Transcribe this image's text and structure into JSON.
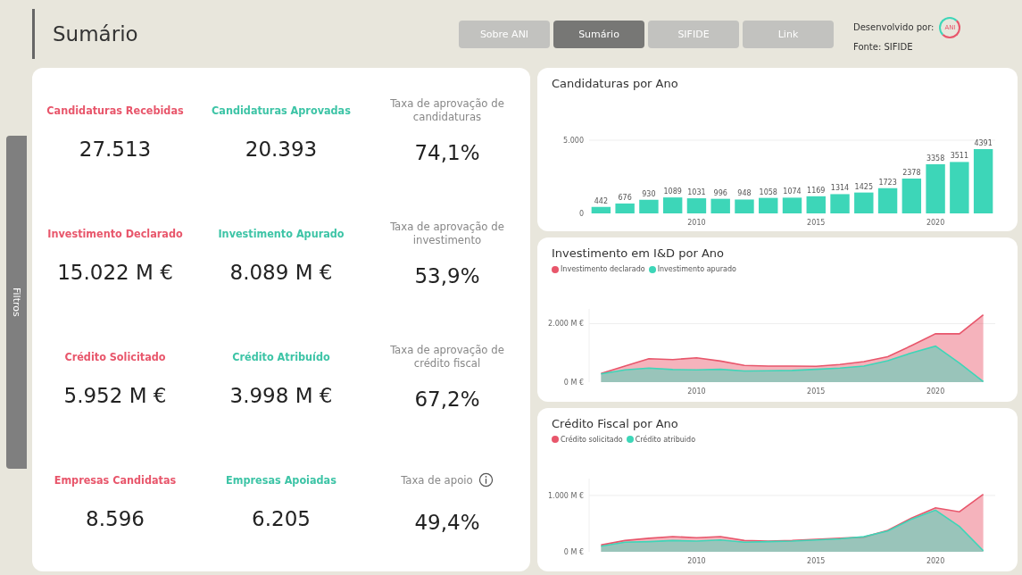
{
  "header": {
    "title": "Sumário",
    "nav": [
      {
        "label": "Sobre ANI",
        "selected": false
      },
      {
        "label": "Sumário",
        "selected": true
      },
      {
        "label": "SIFIDE",
        "selected": false
      },
      {
        "label": "Link",
        "selected": false
      }
    ],
    "developed_by": "Desenvolvido por:",
    "logo_text": "ANI",
    "source": "Fonte: SIFIDE"
  },
  "filters_tab": "Filtros",
  "kpis": [
    [
      {
        "kind": "declared",
        "label": "Candidaturas Recebidas",
        "value": "27.513"
      },
      {
        "kind": "approved",
        "label": "Candidaturas Aprovadas",
        "value": "20.393"
      },
      {
        "kind": "rate",
        "label": "Taxa de aprovação de candidaturas",
        "value": "74,1%",
        "info": false
      }
    ],
    [
      {
        "kind": "declared",
        "label": "Investimento Declarado",
        "value": "15.022 M €"
      },
      {
        "kind": "approved",
        "label": "Investimento Apurado",
        "value": "8.089 M €"
      },
      {
        "kind": "rate",
        "label": "Taxa de aprovação de investimento",
        "value": "53,9%",
        "info": false
      }
    ],
    [
      {
        "kind": "declared",
        "label": "Crédito Solicitado",
        "value": "5.952 M €"
      },
      {
        "kind": "approved",
        "label": "Crédito Atribuído",
        "value": "3.998 M €"
      },
      {
        "kind": "rate",
        "label": "Taxa de aprovação de crédito fiscal",
        "value": "67,2%",
        "info": false
      }
    ],
    [
      {
        "kind": "declared",
        "label": "Empresas Candidatas",
        "value": "8.596"
      },
      {
        "kind": "approved",
        "label": "Empresas Apoiadas",
        "value": "6.205"
      },
      {
        "kind": "rate",
        "label": "Taxa de apoio",
        "value": "49,4%",
        "info": true
      }
    ]
  ],
  "charts": [
    {
      "chart_data": {
        "type": "bar",
        "title": "Candidaturas por Ano",
        "x": [
          2006,
          2007,
          2008,
          2009,
          2010,
          2011,
          2012,
          2013,
          2014,
          2015,
          2016,
          2017,
          2018,
          2019,
          2020,
          2021,
          2022
        ],
        "xlim": [
          2005.5,
          2022.5
        ],
        "series": [
          {
            "color": "#3dd6b8",
            "values": [
              442,
              676,
              930,
              1089,
              1031,
              996,
              948,
              1058,
              1074,
              1169,
              1314,
              1425,
              1723,
              2378,
              3358,
              3511,
              4391
            ]
          }
        ],
        "ylim": [
          0,
          5000
        ],
        "yticks": [
          {
            "value": 0,
            "label": "0"
          },
          {
            "value": 5000,
            "label": "5.000"
          }
        ],
        "xticks": [
          2010,
          2015,
          2020
        ],
        "data_labels": true
      }
    },
    {
      "chart_data": {
        "type": "area",
        "title": "Investimento em I&D por Ano",
        "x": [
          2006,
          2007,
          2008,
          2009,
          2010,
          2011,
          2012,
          2013,
          2014,
          2015,
          2016,
          2017,
          2018,
          2019,
          2020,
          2021,
          2022
        ],
        "xlim": [
          2005.5,
          2022.5
        ],
        "series": [
          {
            "name": "Investimento declarado",
            "color": "#e8566b",
            "values": [
              300,
              550,
              800,
              770,
              830,
              720,
              570,
              550,
              550,
              540,
              600,
              700,
              870,
              1250,
              1650,
              1650,
              2300
            ]
          },
          {
            "name": "Investimento apurado",
            "color": "#3dd6b8",
            "values": [
              280,
              420,
              480,
              430,
              420,
              440,
              380,
              390,
              400,
              440,
              480,
              550,
              730,
              1000,
              1230,
              650,
              20
            ]
          }
        ],
        "ylim": [
          0,
          2500
        ],
        "yticks": [
          {
            "value": 0,
            "label": "0 M €"
          },
          {
            "value": 2000,
            "label": "2.000 M €"
          }
        ],
        "xticks": [
          2010,
          2015,
          2020
        ]
      }
    },
    {
      "chart_data": {
        "type": "area",
        "title": "Crédito Fiscal por Ano",
        "x": [
          2006,
          2007,
          2008,
          2009,
          2010,
          2011,
          2012,
          2013,
          2014,
          2015,
          2016,
          2017,
          2018,
          2019,
          2020,
          2021,
          2022
        ],
        "xlim": [
          2005.5,
          2022.5
        ],
        "series": [
          {
            "name": "Crédito solicitado",
            "color": "#e8566b",
            "values": [
              120,
              200,
              240,
              270,
              250,
              270,
              200,
              190,
              200,
              220,
              240,
              260,
              380,
              600,
              780,
              710,
              1020
            ]
          },
          {
            "name": "Crédito atribuido",
            "color": "#3dd6b8",
            "values": [
              100,
              170,
              180,
              200,
              190,
              210,
              170,
              180,
              190,
              210,
              230,
              270,
              370,
              580,
              740,
              450,
              20
            ]
          }
        ],
        "ylim": [
          0,
          1300
        ],
        "yticks": [
          {
            "value": 0,
            "label": "0 M €"
          },
          {
            "value": 1000,
            "label": "1.000 M €"
          }
        ],
        "xticks": [
          2010,
          2015,
          2020
        ]
      }
    }
  ]
}
